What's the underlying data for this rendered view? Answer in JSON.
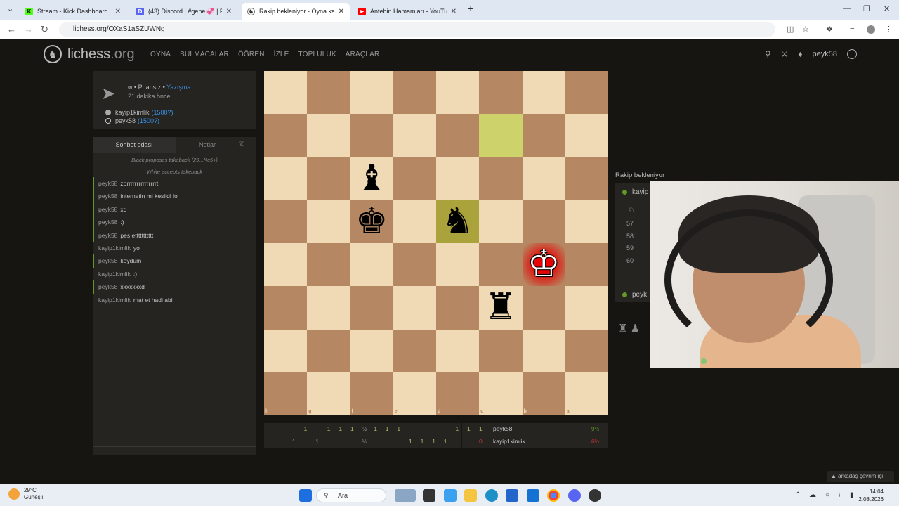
{
  "browser": {
    "tabs": [
      {
        "title": "Stream - Kick Dashboard",
        "favicon_color": "#53fc18",
        "favicon_glyph": "K",
        "active": false
      },
      {
        "title": "(43) Discord | #genel💞 | P",
        "favicon_color": "#5865f2",
        "favicon_glyph": "D",
        "active": false
      },
      {
        "title": "Rakip bekleniyor - Oyna kayip1",
        "favicon_color": "#555555",
        "favicon_glyph": "♞",
        "active": true
      },
      {
        "title": "Antebin Hamamları - YouTube",
        "favicon_color": "#ff0000",
        "favicon_glyph": "▶",
        "active": false
      }
    ],
    "url": "lichess.org/OXaS1aSZUWNg"
  },
  "site": {
    "logo_text": "lichess",
    "logo_tld": ".org",
    "nav": [
      "OYNA",
      "BULMACALAR",
      "ÖĞREN",
      "İZLE",
      "TOPLULUK",
      "ARAÇLAR"
    ],
    "username": "peyk58"
  },
  "game_info": {
    "mode_prefix": "∞ • Puansız • ",
    "mode_link": "Yazışma",
    "time_ago": "21 dakika önce",
    "player_black": {
      "name": "kayip1kimlik",
      "rating": "(1500?)"
    },
    "player_white": {
      "name": "peyk58",
      "rating": "(1500?)"
    }
  },
  "chat": {
    "tab_room": "Sohbet odası",
    "tab_notes": "Notlar",
    "system": [
      "Black proposes takeback (29...Nc5+)",
      "White accepts takeback"
    ],
    "messages": [
      {
        "user": "peyk58",
        "text": "zorrrrrrrrrrrrrrrt",
        "me": true
      },
      {
        "user": "peyk58",
        "text": "internetin mi kesildi lo",
        "me": true
      },
      {
        "user": "peyk58",
        "text": "xd",
        "me": true
      },
      {
        "user": "peyk58",
        "text": ":)",
        "me": true
      },
      {
        "user": "peyk58",
        "text": "pes ettttttttttt",
        "me": true
      },
      {
        "user": "kayip1kimlik",
        "text": "yo",
        "me": false
      },
      {
        "user": "peyk58",
        "text": "koydum",
        "me": true
      },
      {
        "user": "kayip1kimlik",
        "text": ":)",
        "me": false
      },
      {
        "user": "peyk58",
        "text": "xxxxxxxd",
        "me": true
      },
      {
        "user": "kayip1kimlik",
        "text": "mat et hadi abi",
        "me": false
      }
    ]
  },
  "board": {
    "ranks": [
      "1",
      "2",
      "3",
      "4",
      "5",
      "6",
      "7",
      "8"
    ],
    "files": [
      "h",
      "g",
      "f",
      "e",
      "d",
      "c",
      "b",
      "a"
    ],
    "highlights": [
      {
        "row": 1,
        "col": 5,
        "kind": "last-move"
      },
      {
        "row": 3,
        "col": 4,
        "kind": "last-move-dark"
      },
      {
        "row": 4,
        "col": 6,
        "kind": "check"
      }
    ],
    "pieces": [
      {
        "row": 2,
        "col": 2,
        "glyph": "♝",
        "color": "black",
        "name": "black-bishop"
      },
      {
        "row": 3,
        "col": 2,
        "glyph": "♚",
        "color": "black",
        "name": "black-king"
      },
      {
        "row": 3,
        "col": 4,
        "glyph": "♞",
        "color": "black",
        "name": "black-knight"
      },
      {
        "row": 4,
        "col": 6,
        "glyph": "♔",
        "color": "white",
        "name": "white-king"
      },
      {
        "row": 5,
        "col": 5,
        "glyph": "♜",
        "color": "black",
        "name": "black-rook"
      }
    ]
  },
  "score": {
    "row1": {
      "cells": [
        "",
        "1",
        "",
        "1",
        "1",
        "1",
        "½",
        "1",
        "1",
        "1",
        "",
        "",
        "",
        "",
        "1",
        "1"
      ],
      "total": "1",
      "name": "peyk58",
      "pct": "9½",
      "pct_color": "#629924"
    },
    "row2": {
      "cells": [
        "1",
        "",
        "1",
        "",
        "",
        "",
        "½",
        "",
        "",
        "",
        "1",
        "1",
        "1",
        "1",
        "",
        ""
      ],
      "total": "0",
      "name": "kayip1kimlik",
      "pct": "6½",
      "pct_color": "#cc3333"
    }
  },
  "right_panel": {
    "waiting": "Rakip bekleniyor",
    "top_player": "kayip",
    "moves": [
      "57",
      "58",
      "59",
      "60"
    ],
    "bottom_player": "peyk"
  },
  "friends_label": "arkadaş çevrim içi",
  "taskbar": {
    "temp": "29°C",
    "weather": "Güneşli",
    "search": "Ara",
    "time": "14:04",
    "date": "2.08.2026"
  }
}
